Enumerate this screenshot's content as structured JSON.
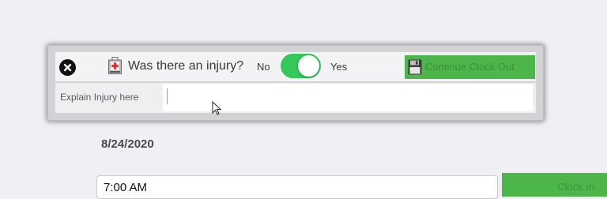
{
  "injury_dialog": {
    "question": "Was there an injury?",
    "no_label": "No",
    "yes_label": "Yes",
    "toggle_state": "on",
    "continue_label": "Continue Clock Out",
    "explain_label": "Explain Injury here",
    "explain_value": ""
  },
  "main": {
    "date": "8/24/2020",
    "time_value": "7:00 AM",
    "clock_button_label": "Clock In"
  },
  "colors": {
    "accent_green": "#4cb64a",
    "toggle_on": "#34c759"
  },
  "icons": [
    "close-icon",
    "first-aid-kit-icon",
    "floppy-disk-icon",
    "mouse-cursor-icon"
  ]
}
